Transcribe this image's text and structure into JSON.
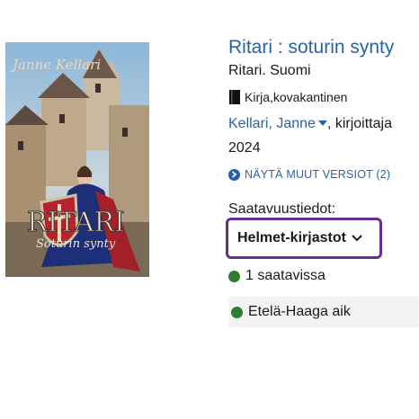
{
  "cover": {
    "author_text": "Janne Kellari",
    "title_text": "RITARI",
    "subtitle_text": "Soturin synty"
  },
  "book": {
    "title": "Ritari : soturin synty",
    "subtitle": "Ritari. Suomi",
    "format_icon": "book-icon",
    "format": "Kirja,kovakantinen",
    "author": "Kellari, Janne",
    "author_role": ", kirjoittaja",
    "year": "2024",
    "other_versions": "NÄYTÄ MUUT VERSIOT (2)"
  },
  "availability": {
    "heading": "Saatavuustiedot:",
    "library_select": "Helmet-kirjastot",
    "available_count": "1 saatavissa",
    "branch": "Etelä-Haaga aik",
    "status_color": "#2e7d32"
  },
  "colors": {
    "link": "#2a63a6",
    "focus_border": "#6b2d8f"
  }
}
